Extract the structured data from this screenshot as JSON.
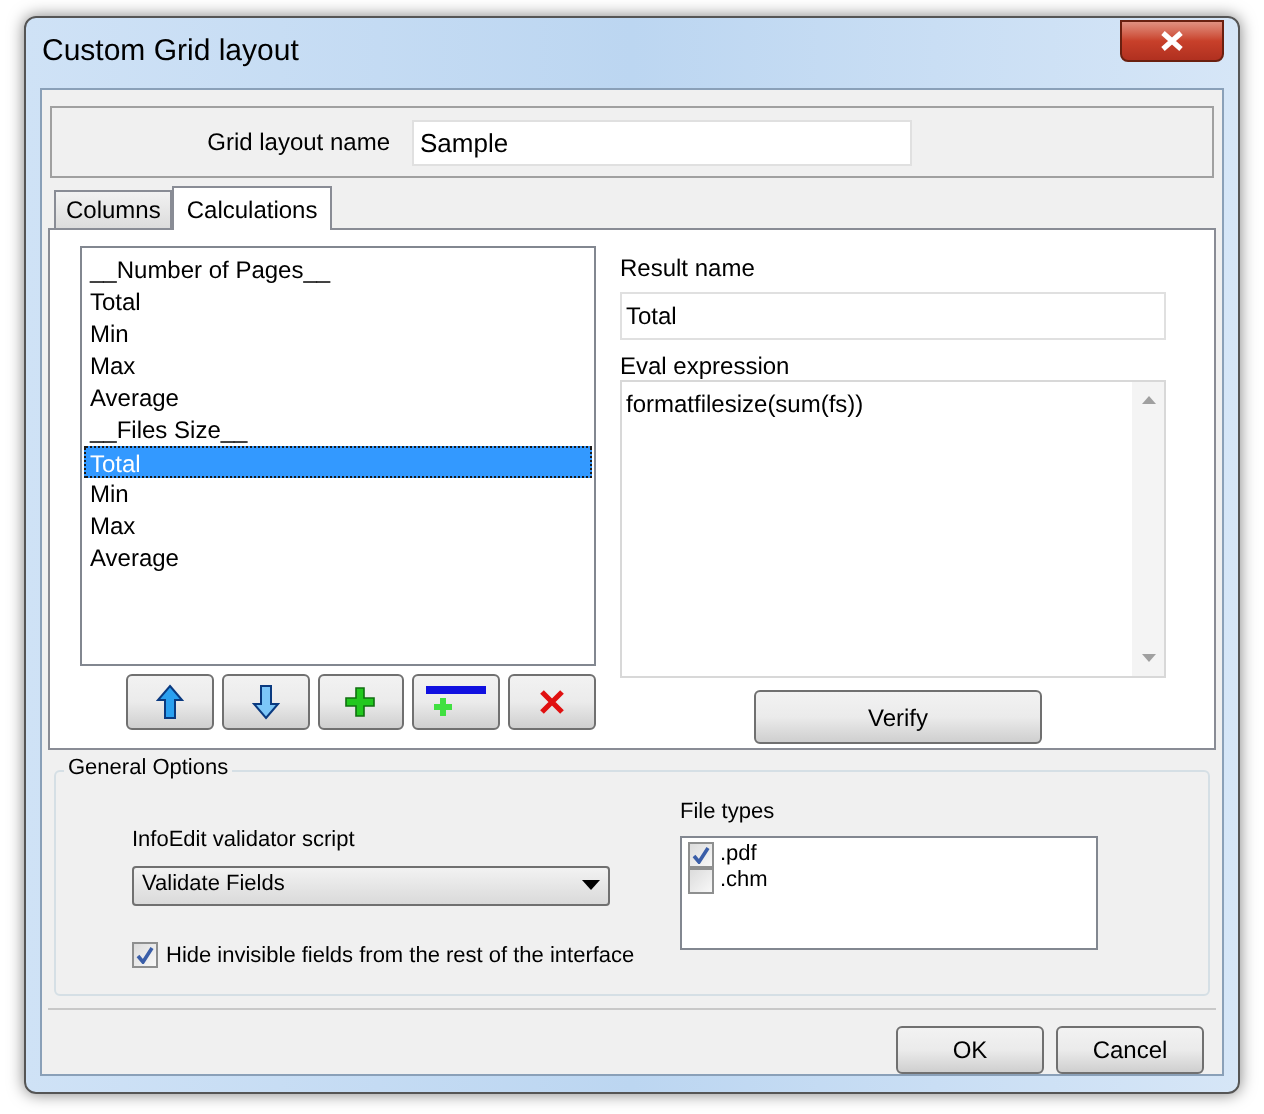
{
  "window": {
    "title": "Custom Grid layout"
  },
  "grid_layout_name": {
    "label": "Grid layout name",
    "value": "Sample"
  },
  "tabs": [
    {
      "label": "Columns",
      "selected": false
    },
    {
      "label": "Calculations",
      "selected": true
    }
  ],
  "calculations": [
    {
      "label": "__Number of Pages__",
      "selected": false
    },
    {
      "label": "Total",
      "selected": false
    },
    {
      "label": "Min",
      "selected": false
    },
    {
      "label": "Max",
      "selected": false
    },
    {
      "label": "Average",
      "selected": false
    },
    {
      "label": "__Files Size__",
      "selected": false
    },
    {
      "label": "Total",
      "selected": true
    },
    {
      "label": "Min",
      "selected": false
    },
    {
      "label": "Max",
      "selected": false
    },
    {
      "label": "Average",
      "selected": false
    }
  ],
  "list_buttons": [
    {
      "kind": "up"
    },
    {
      "kind": "down"
    },
    {
      "kind": "add"
    },
    {
      "kind": "remove"
    },
    {
      "kind": "delete"
    }
  ],
  "result_name": {
    "label": "Result name",
    "value": "Total"
  },
  "eval_expression": {
    "label": "Eval expression",
    "value": "formatfilesize(sum(fs))"
  },
  "verify_button": "Verify",
  "general_options": {
    "title": "General Options",
    "validator_label": "InfoEdit validator script",
    "validator_value": "Validate Fields",
    "hide_invisible": {
      "label": "Hide invisible fields from the rest of the interface",
      "checked": true
    },
    "file_types_label": "File types",
    "file_types": [
      {
        "label": ".pdf",
        "checked": true
      },
      {
        "label": ".chm",
        "checked": false
      }
    ]
  },
  "buttons": [
    "OK",
    "Cancel"
  ]
}
